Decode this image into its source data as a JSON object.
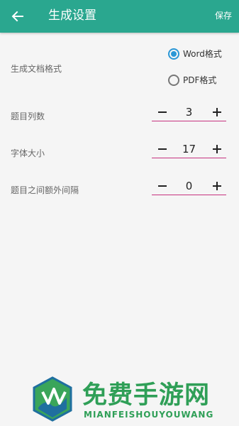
{
  "header": {
    "title": "生成设置",
    "save_label": "保存",
    "back_icon": "arrow-left-icon"
  },
  "format": {
    "label": "生成文档格式",
    "options": [
      {
        "label": "Word格式",
        "selected": true
      },
      {
        "label": "PDF格式",
        "selected": false
      }
    ]
  },
  "settings": [
    {
      "label": "题目列数",
      "value": "3"
    },
    {
      "label": "字体大小",
      "value": "17"
    },
    {
      "label": "题目之间额外间隔",
      "value": "0"
    }
  ],
  "watermark": {
    "title": "免费手游网",
    "subtitle": "MIANFEISHOUYOUWANG"
  },
  "colors": {
    "header": "#2aa78f",
    "radio_accent": "#2a97d6",
    "stepper_underline": "#c6327f",
    "watermark": "#2f9f57"
  }
}
